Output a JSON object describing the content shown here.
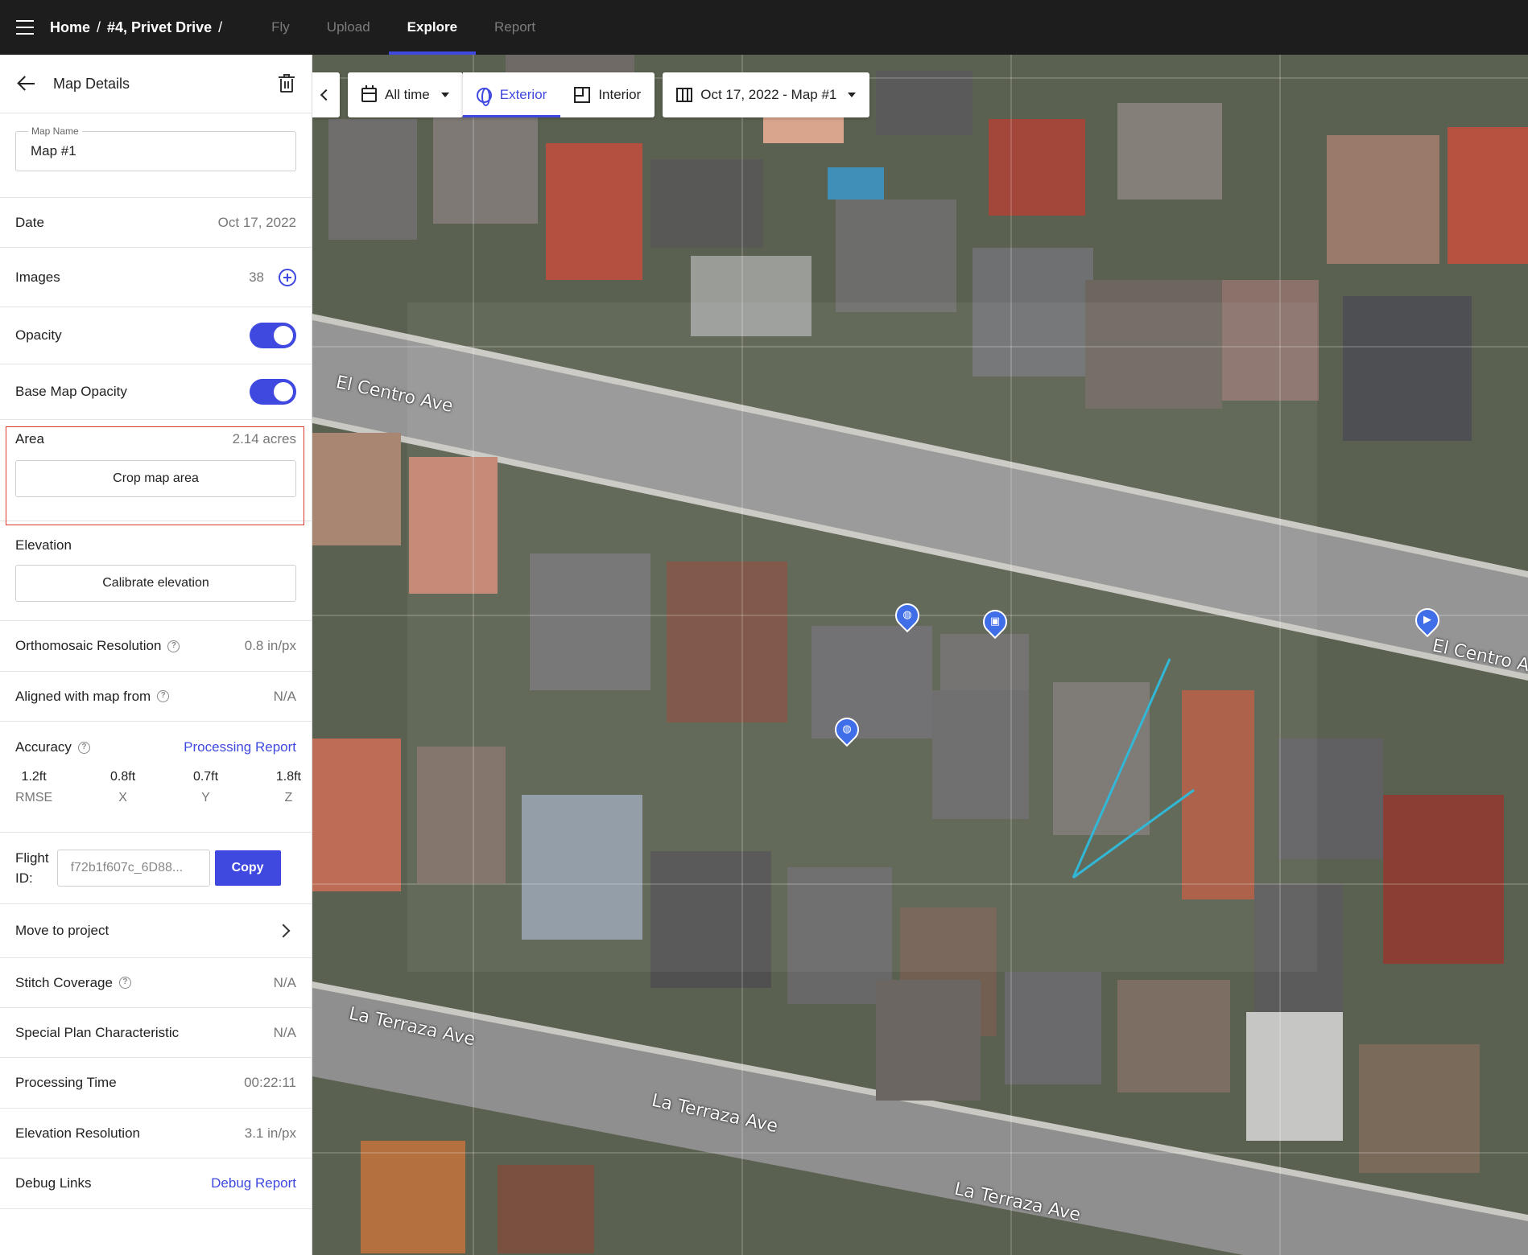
{
  "topbar": {
    "breadcrumbs": [
      "Home",
      "#4, Privet Drive"
    ],
    "separator": "/",
    "tabs": [
      {
        "label": "Fly",
        "active": false
      },
      {
        "label": "Upload",
        "active": false
      },
      {
        "label": "Explore",
        "active": true
      },
      {
        "label": "Report",
        "active": false
      }
    ]
  },
  "sidebar": {
    "title": "Map Details",
    "map_name": {
      "label": "Map Name",
      "value": "Map #1"
    },
    "date": {
      "label": "Date",
      "value": "Oct 17, 2022"
    },
    "images": {
      "label": "Images",
      "value": "38"
    },
    "opacity": {
      "label": "Opacity",
      "on": true
    },
    "base_map_opacity": {
      "label": "Base Map Opacity",
      "on": true
    },
    "area": {
      "label": "Area",
      "value": "2.14 acres",
      "button": "Crop map area"
    },
    "elevation": {
      "label": "Elevation",
      "button": "Calibrate elevation"
    },
    "ortho_resolution": {
      "label": "Orthomosaic Resolution",
      "value": "0.8 in/px"
    },
    "aligned": {
      "label": "Aligned with map from",
      "value": "N/A"
    },
    "accuracy": {
      "label": "Accuracy",
      "link": "Processing Report",
      "metrics": [
        {
          "value": "1.2ft",
          "key": "RMSE"
        },
        {
          "value": "0.8ft",
          "key": "X"
        },
        {
          "value": "0.7ft",
          "key": "Y"
        },
        {
          "value": "1.8ft",
          "key": "Z"
        }
      ]
    },
    "flight_id": {
      "label_line1": "Flight",
      "label_line2": "ID:",
      "value": "f72b1f607c_6D88...",
      "button": "Copy"
    },
    "move_to_project": {
      "label": "Move to project"
    },
    "stitch_coverage": {
      "label": "Stitch Coverage",
      "value": "N/A"
    },
    "special_plan": {
      "label": "Special Plan Characteristic",
      "value": "N/A"
    },
    "processing_time": {
      "label": "Processing Time",
      "value": "00:22:11"
    },
    "elevation_resolution": {
      "label": "Elevation Resolution",
      "value": "3.1 in/px"
    },
    "debug_links": {
      "label": "Debug Links",
      "link": "Debug Report"
    }
  },
  "map": {
    "toolbar": {
      "time_filter": "All time",
      "exterior": "Exterior",
      "interior": "Interior",
      "map_select": "Oct 17, 2022 - Map #1"
    },
    "streets": [
      "El Centro Ave",
      "El Centro Av",
      "La Terraza Ave",
      "La Terraza Ave",
      "La Terraza Ave"
    ],
    "pins": [
      "globe",
      "camera",
      "globe",
      "video"
    ],
    "colors": {
      "accent": "#3f49e0",
      "pin": "#3f6ee8",
      "highlight": "#e03a2f",
      "measure_line": "#31b8d6"
    }
  }
}
